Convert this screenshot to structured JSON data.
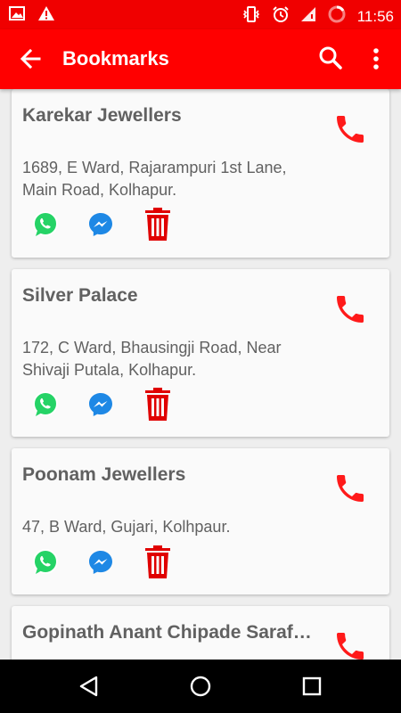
{
  "status_bar": {
    "time": "11:56",
    "left_icons": [
      "image-icon",
      "warning-icon"
    ],
    "right_icons": [
      "vibrate-icon",
      "alarm-icon",
      "signal-icon",
      "battery-icon"
    ]
  },
  "app_bar": {
    "title": "Bookmarks",
    "back_icon": "arrow-left-icon",
    "search_icon": "search-icon",
    "menu_icon": "more-vert-icon"
  },
  "colors": {
    "primary": "#ff0000",
    "status_bar": "#f00000",
    "text": "#616161",
    "whatsapp": "#25d366",
    "messenger": "#1e88e5",
    "delete": "#e00000"
  },
  "bookmarks": [
    {
      "name": "Karekar Jewellers",
      "address": "1689, E Ward, Rajarampuri 1st Lane, Main Road, Kolhapur."
    },
    {
      "name": "Silver Palace",
      "address": "172, C Ward, Bhausingji Road, Near Shivaji Putala, Kolhapur."
    },
    {
      "name": "Poonam Jewellers",
      "address": "47, B Ward, Gujari, Kolhpaur."
    },
    {
      "name": "Gopinath Anant Chipade Saraf and Sons",
      "address": ""
    }
  ],
  "nav_bar": {
    "icons": [
      "back-triangle-icon",
      "home-circle-icon",
      "recents-square-icon"
    ]
  }
}
